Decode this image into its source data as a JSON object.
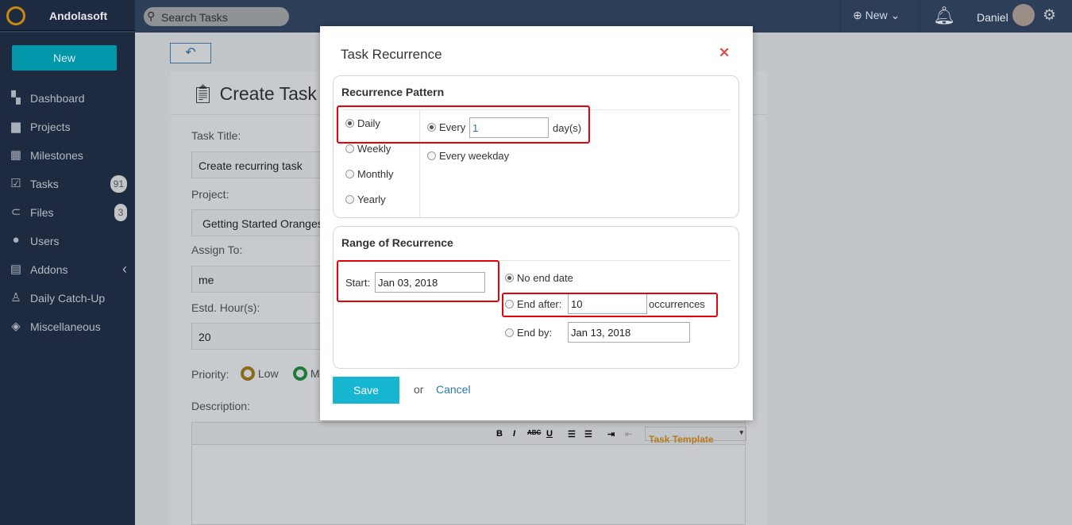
{
  "topbar": {
    "brand": "Andolasoft",
    "search_placeholder": "Search Tasks",
    "new_label": "New",
    "user_name": "Daniel"
  },
  "sidebar": {
    "new_button": "New",
    "items": [
      {
        "label": "Dashboard",
        "icon": "dashboard-icon",
        "glyph": "▚"
      },
      {
        "label": "Projects",
        "icon": "briefcase-icon",
        "glyph": "▆"
      },
      {
        "label": "Milestones",
        "icon": "grid-icon",
        "glyph": "▦"
      },
      {
        "label": "Tasks",
        "icon": "clipboard-check-icon",
        "glyph": "☑",
        "badge": "91"
      },
      {
        "label": "Files",
        "icon": "paperclip-icon",
        "glyph": "⊂",
        "badge": "3"
      },
      {
        "label": "Users",
        "icon": "user-icon",
        "glyph": "●"
      },
      {
        "label": "Addons",
        "icon": "addons-icon",
        "glyph": "▤",
        "chevron": "‹"
      },
      {
        "label": "Daily Catch-Up",
        "icon": "bell-plus-icon",
        "glyph": "♙"
      },
      {
        "label": "Miscellaneous",
        "icon": "layers-icon",
        "glyph": "◈"
      }
    ]
  },
  "form": {
    "title": "Create Task",
    "task_title_label": "Task Title:",
    "task_title": "Create recurring task",
    "project_label": "Project:",
    "project": "Getting Started Oranges",
    "assign_label": "Assign To:",
    "assign": "me",
    "hours_label": "Estd. Hour(s):",
    "hours": "20",
    "priority_label": "Priority:",
    "priority_low": "Low",
    "priority_medium": "M",
    "description_label": "Description:",
    "template": "Task Template"
  },
  "modal": {
    "title": "Task Recurrence",
    "pattern_heading": "Recurrence Pattern",
    "patterns": [
      "Daily",
      "Weekly",
      "Monthly",
      "Yearly"
    ],
    "selected_pattern": "Daily",
    "every_label": "Every",
    "every_value": "1",
    "days_unit": "day(s)",
    "every_weekday": "Every weekday",
    "range_heading": "Range of Recurrence",
    "start_label": "Start:",
    "start_value": "Jan 03, 2018",
    "no_end": "No end date",
    "end_after_label": "End after:",
    "end_after_value": "10",
    "occurrences": "occurrences",
    "end_by_label": "End by:",
    "end_by_value": "Jan 13, 2018",
    "save": "Save",
    "or": "or",
    "cancel": "Cancel"
  },
  "colors": {
    "accent": "#16b5d0",
    "highlight": "#e8000b",
    "sidebar": "#1e2a40"
  }
}
